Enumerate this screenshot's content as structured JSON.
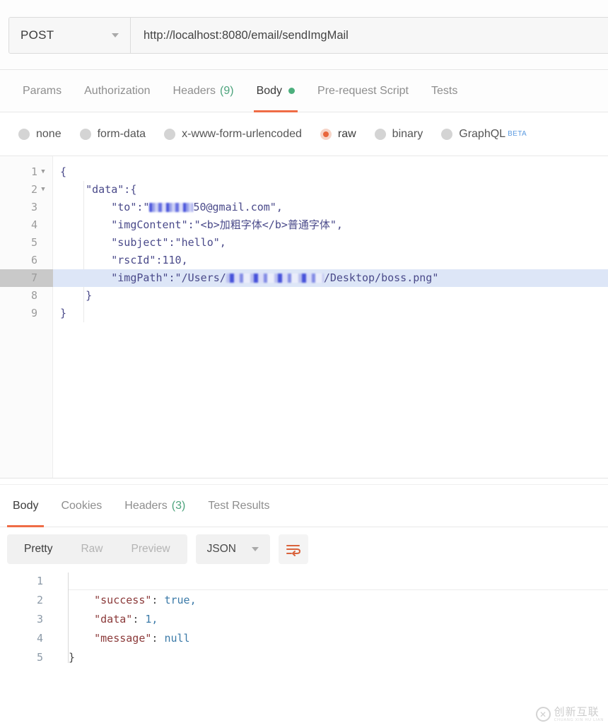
{
  "request_bar": {
    "method": "POST",
    "method_caret": "chevron-down-icon",
    "url": "http://localhost:8080/email/sendImgMail"
  },
  "request_tabs": [
    {
      "label": "Params",
      "active": false,
      "count": null,
      "dot": false
    },
    {
      "label": "Authorization",
      "active": false,
      "count": null,
      "dot": false
    },
    {
      "label": "Headers",
      "active": false,
      "count": "(9)",
      "dot": false
    },
    {
      "label": "Body",
      "active": true,
      "count": null,
      "dot": true
    },
    {
      "label": "Pre-request Script",
      "active": false,
      "count": null,
      "dot": false
    },
    {
      "label": "Tests",
      "active": false,
      "count": null,
      "dot": false
    }
  ],
  "body_types": [
    {
      "label": "none",
      "checked": false,
      "beta": null
    },
    {
      "label": "form-data",
      "checked": false,
      "beta": null
    },
    {
      "label": "x-www-form-urlencoded",
      "checked": false,
      "beta": null
    },
    {
      "label": "raw",
      "checked": true,
      "beta": null
    },
    {
      "label": "binary",
      "checked": false,
      "beta": null
    },
    {
      "label": "GraphQL",
      "checked": false,
      "beta": "BETA"
    }
  ],
  "request_body": {
    "language": "json",
    "highlighted_line": 7,
    "lines": [
      {
        "n": "1",
        "fold": true,
        "text": "{"
      },
      {
        "n": "2",
        "fold": true,
        "text": "    \"data\":{"
      },
      {
        "n": "3",
        "fold": false,
        "text": "        \"to\":\"",
        "redacted": "redact-a",
        "text_after": "50@gmail.com\","
      },
      {
        "n": "4",
        "fold": false,
        "text": "        \"imgContent\":\"<b>加粗字体</b>普通字体\","
      },
      {
        "n": "5",
        "fold": false,
        "text": "        \"subject\":\"hello\","
      },
      {
        "n": "6",
        "fold": false,
        "text": "        \"rscId\":110,"
      },
      {
        "n": "7",
        "fold": false,
        "text": "        \"imgPath\":\"/Users/",
        "redacted": "redact-b",
        "text_after": "/Desktop/boss.png\""
      },
      {
        "n": "8",
        "fold": false,
        "text": "    }"
      },
      {
        "n": "9",
        "fold": false,
        "text": "}"
      }
    ]
  },
  "response_tabs": [
    {
      "label": "Body",
      "active": true,
      "count": null
    },
    {
      "label": "Cookies",
      "active": false,
      "count": null
    },
    {
      "label": "Headers",
      "active": false,
      "count": "(3)"
    },
    {
      "label": "Test Results",
      "active": false,
      "count": null
    }
  ],
  "response_toolbar": {
    "view_modes": [
      {
        "label": "Pretty",
        "active": true
      },
      {
        "label": "Raw",
        "active": false
      },
      {
        "label": "Preview",
        "active": false
      }
    ],
    "format": "JSON",
    "format_caret": "chevron-down-icon",
    "wrap_icon": "word-wrap-icon"
  },
  "response_body": {
    "lines": [
      {
        "n": "1",
        "key": "",
        "punc": "{",
        "val": ""
      },
      {
        "n": "2",
        "key": "    \"success\"",
        "punc": ": ",
        "val": "true,"
      },
      {
        "n": "3",
        "key": "    \"data\"",
        "punc": ": ",
        "val": "1,"
      },
      {
        "n": "4",
        "key": "    \"message\"",
        "punc": ": ",
        "val": "null"
      },
      {
        "n": "5",
        "key": "",
        "punc": "}",
        "val": ""
      }
    ]
  },
  "watermark": {
    "logo_glyph": "✕",
    "cn": "创新互联",
    "en": "CHUANG XIN HU LIAN"
  },
  "colors": {
    "accent_orange": "#ef6c46",
    "tab_count_green": "#4ca37c",
    "body_dot_green": "#4caf7d",
    "beta_blue": "#5b9ae0",
    "code_purple": "#4a4a8a",
    "resp_key_maroon": "#8b3a3a",
    "resp_value_blue": "#3b7aa8",
    "highlight_row_blue": "#dde6f7"
  }
}
